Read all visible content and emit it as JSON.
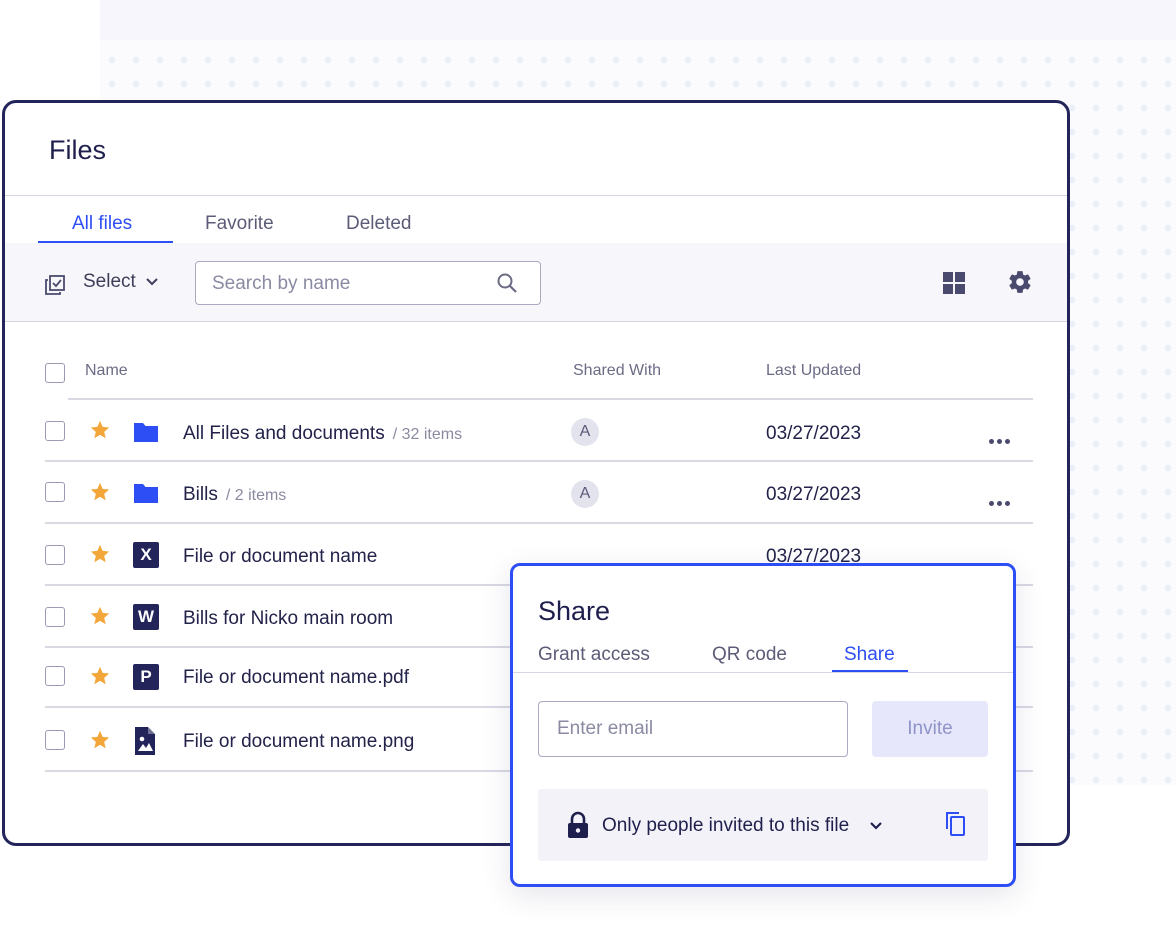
{
  "page": {
    "title": "Files"
  },
  "tabs": [
    {
      "label": "All files",
      "active": true
    },
    {
      "label": "Favorite",
      "active": false
    },
    {
      "label": "Deleted",
      "active": false
    }
  ],
  "toolbar": {
    "select_label": "Select",
    "search_placeholder": "Search by name",
    "icons": [
      "select-checkbox-icon",
      "chevron-down-icon",
      "search-icon",
      "grid-view-icon",
      "gear-icon"
    ]
  },
  "columns": {
    "name": "Name",
    "shared_with": "Shared With",
    "last_updated": "Last Updated"
  },
  "rows": [
    {
      "name": "All Files and documents",
      "count": "/ 32 items",
      "type": "folder-icon",
      "shared": "A",
      "date": "03/27/2023"
    },
    {
      "name": "Bills",
      "count": "/ 2 items",
      "type": "folder-icon",
      "shared": "A",
      "date": "03/27/2023"
    },
    {
      "name": "File or document name",
      "count": "",
      "type": "excel-file-icon",
      "letter": "X",
      "shared": "",
      "date": "03/27/2023"
    },
    {
      "name": "Bills for Nicko main room",
      "count": "",
      "type": "word-file-icon",
      "letter": "W",
      "shared": "",
      "date": ""
    },
    {
      "name": "File or document name.pdf",
      "count": "",
      "type": "powerpoint-file-icon",
      "letter": "P",
      "shared": "",
      "date": ""
    },
    {
      "name": "File or document name.png",
      "count": "",
      "type": "image-file-icon",
      "shared": "",
      "date": ""
    }
  ],
  "share": {
    "title": "Share",
    "tabs": [
      {
        "label": "Grant access",
        "active": false
      },
      {
        "label": "QR code",
        "active": false
      },
      {
        "label": "Share",
        "active": true
      }
    ],
    "email_placeholder": "Enter email",
    "invite_label": "Invite",
    "access_label": "Only people invited to this file"
  },
  "colors": {
    "accent": "#2d4ef5",
    "navy": "#23255a",
    "star": "#f3a73b",
    "folder": "#2d4ef5"
  }
}
